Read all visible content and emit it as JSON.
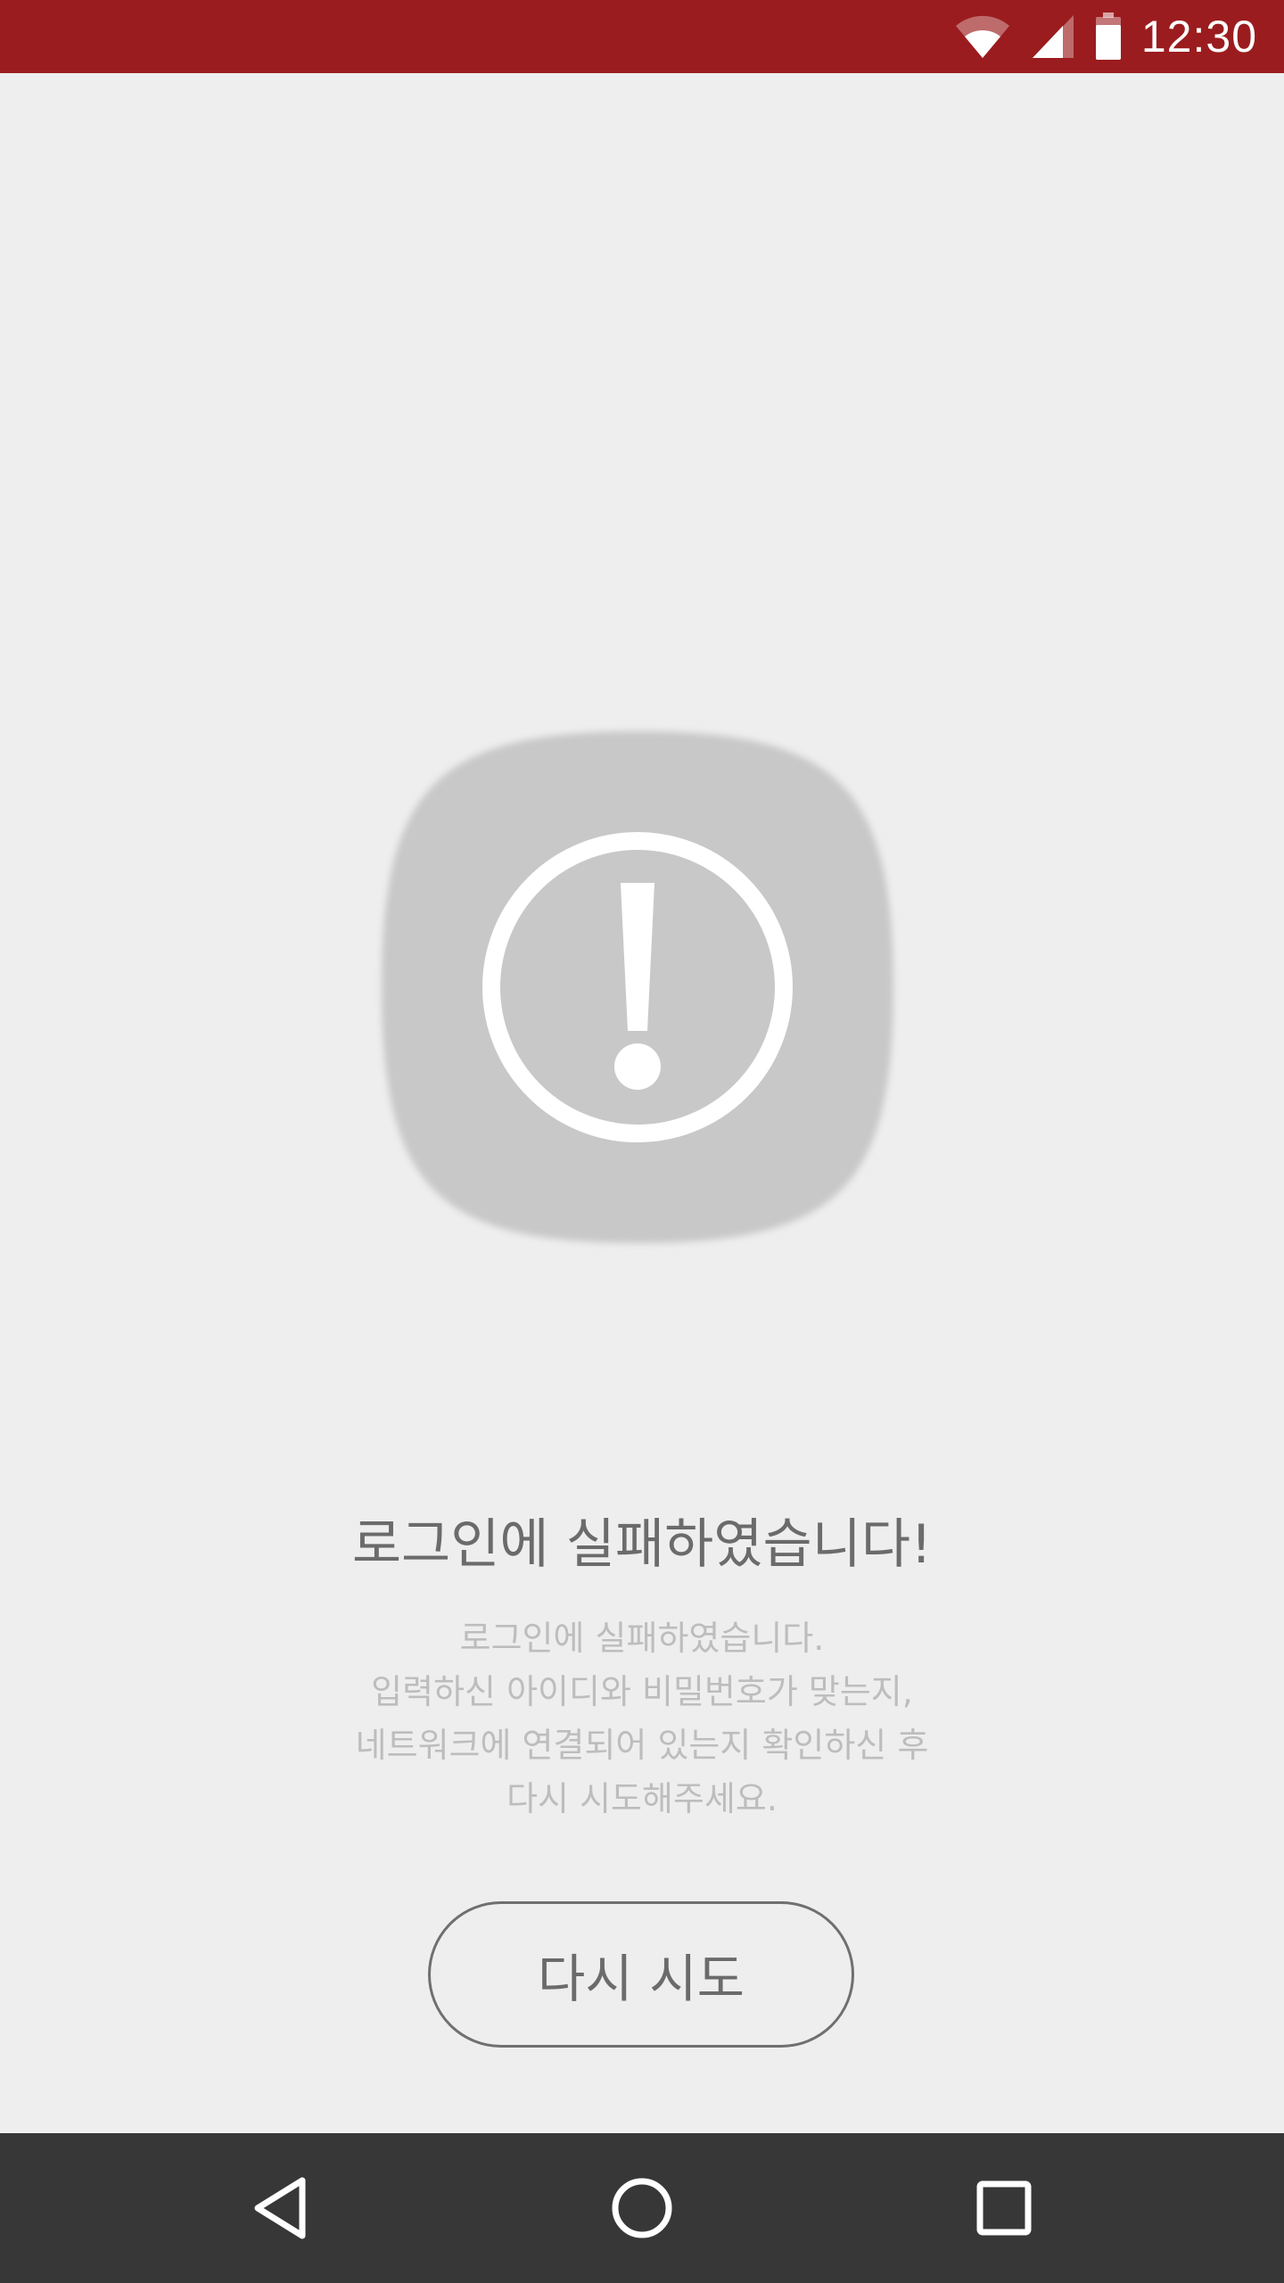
{
  "status_bar": {
    "time": "12:30",
    "icons": [
      "wifi-icon",
      "cellular-signal-icon",
      "battery-icon"
    ],
    "color": "#9b1c1e"
  },
  "alert": {
    "icon": "exclamation-circle-icon",
    "badge_color": "#c8c8c8",
    "title": "로그인에 실패하였습니다!",
    "message_lines": [
      "로그인에 실패하였습니다.",
      "입력하신 아이디와 비밀번호가 맞는지,",
      "네트워크에 연결되어 있는지 확인하신 후",
      "다시 시도해주세요."
    ]
  },
  "actions": {
    "retry_label": "다시 시도"
  },
  "nav_bar": {
    "buttons": [
      "back-icon",
      "home-icon",
      "recents-icon"
    ],
    "color": "#373737"
  }
}
